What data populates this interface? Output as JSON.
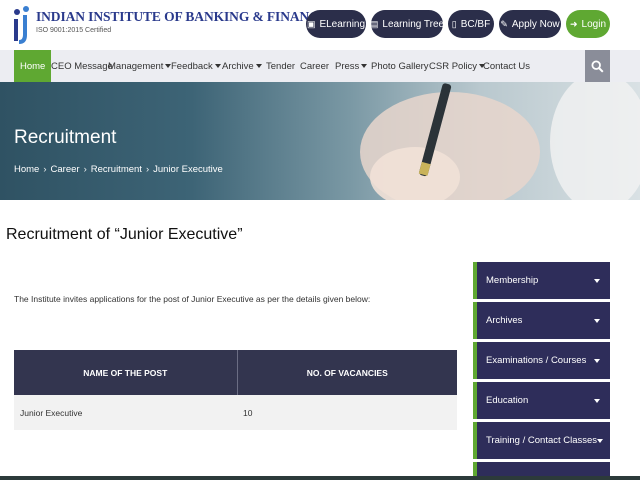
{
  "header": {
    "brand_name": "INDIAN INSTITUTE OF BANKING & FINANCE",
    "brand_sub": "ISO 9001:2015 Certified",
    "buttons": [
      {
        "label": "ELearning",
        "icon": "monitor-icon"
      },
      {
        "label": "Learning Tree",
        "icon": "book-icon"
      },
      {
        "label": "BC/BF",
        "icon": "document-icon"
      },
      {
        "label": "Apply Now",
        "icon": "pencil-icon"
      },
      {
        "label": "Login",
        "icon": "login-icon"
      }
    ],
    "colors": {
      "dark_button": "#2b2e4a",
      "accent_green": "#5fa832",
      "brand_blue": "#2a3a8c"
    }
  },
  "nav": {
    "items": [
      {
        "label": "Home",
        "active": true
      },
      {
        "label": "CEO Message"
      },
      {
        "label": "Management",
        "dropdown": true
      },
      {
        "label": "Feedback",
        "dropdown": true
      },
      {
        "label": "Archive",
        "dropdown": true
      },
      {
        "label": "Tender"
      },
      {
        "label": "Career"
      },
      {
        "label": "Press",
        "dropdown": true
      },
      {
        "label": "Photo Gallery"
      },
      {
        "label": "CSR Policy",
        "dropdown": true
      },
      {
        "label": "Contact Us"
      }
    ],
    "search_icon": "search-icon"
  },
  "banner": {
    "title": "Recruitment",
    "breadcrumb": [
      "Home",
      "Career",
      "Recruitment",
      "Junior Executive"
    ]
  },
  "main": {
    "page_title": "Recruitment of “Junior Executive”",
    "intro": "The Institute invites applications for the post of Junior Executive as per the details given below:",
    "table": {
      "headers": [
        "NAME OF THE POST",
        "NO. OF VACANCIES"
      ],
      "rows": [
        [
          "Junior Executive",
          "10"
        ]
      ]
    }
  },
  "sidebar": {
    "items": [
      {
        "label": "Membership"
      },
      {
        "label": "Archives"
      },
      {
        "label": "Examinations / Courses"
      },
      {
        "label": "Education"
      },
      {
        "label": "Training / Contact Classes"
      }
    ],
    "colors": {
      "item_bg": "#2e2d5a",
      "border": "#5fa832"
    }
  }
}
